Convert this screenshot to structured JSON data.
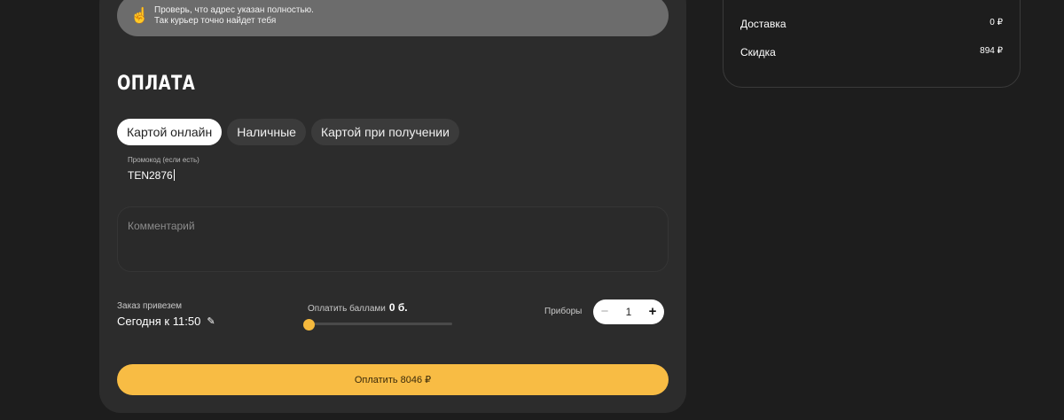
{
  "address_hint": {
    "icon": "pointing-finger-icon",
    "line1": "Проверь, что адрес указан полностью.",
    "line2": "Так курьер точно найдет тебя"
  },
  "payment": {
    "title": "ОПЛАТА",
    "tabs": [
      {
        "label": "Картой онлайн",
        "active": true
      },
      {
        "label": "Наличные",
        "active": false
      },
      {
        "label": "Картой при получении",
        "active": false
      }
    ]
  },
  "promo": {
    "label": "Промокод (если есть)",
    "value": "TEN2876"
  },
  "comment": {
    "placeholder": "Комментарий"
  },
  "delivery": {
    "label": "Заказ привезем",
    "time": "Сегодня к 11:50"
  },
  "points": {
    "label": "Оплатить баллами",
    "value": "0 б.",
    "slider_fraction": 0
  },
  "cutlery": {
    "label": "Приборы",
    "count": "1",
    "minus": "−",
    "plus": "+"
  },
  "pay_button": {
    "label": "Оплатить 8046 ₽"
  },
  "summary": {
    "rows": [
      {
        "label": "Доставка",
        "value": "0 ₽"
      },
      {
        "label": "Скидка",
        "value": "894 ₽"
      }
    ]
  },
  "colors": {
    "accent": "#f8bc44",
    "card_bg": "#2c2c2c",
    "page_bg": "#1d1d1d"
  }
}
